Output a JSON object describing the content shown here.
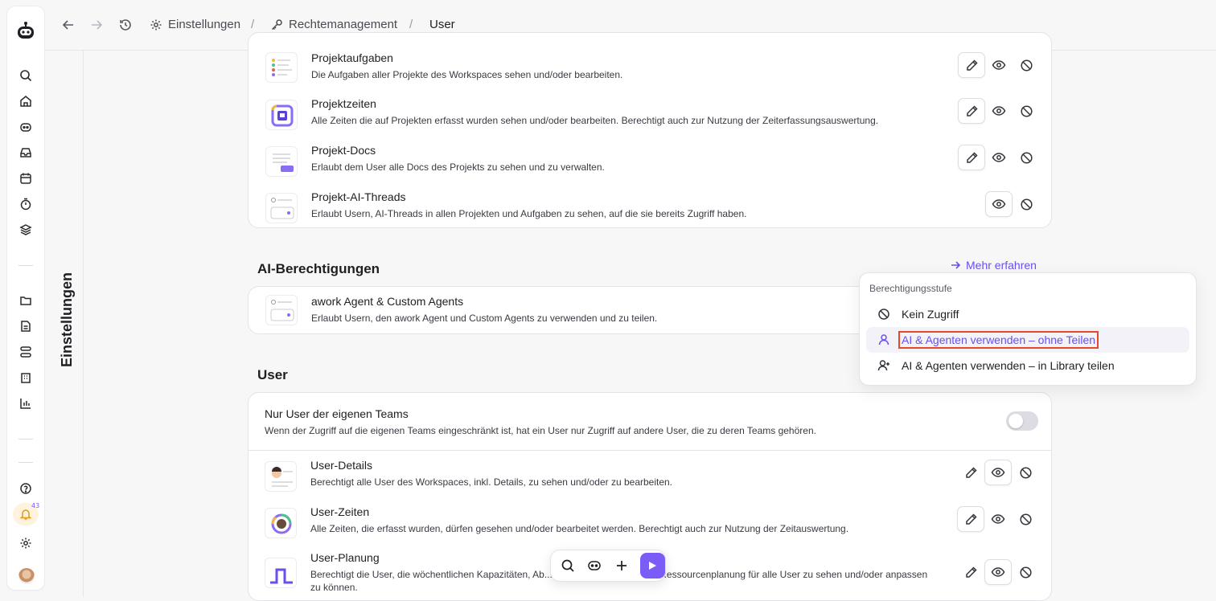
{
  "header": {
    "crumbs": [
      {
        "label": "Einstellungen",
        "icon": "gear-icon"
      },
      {
        "label": "Rechtemanagement",
        "icon": "key-icon"
      },
      {
        "label": "User",
        "icon": ""
      }
    ],
    "separator": "/"
  },
  "sidebar": {
    "vertical_label": "Einstellungen",
    "notification_count": "43",
    "icons": [
      "robot-logo-icon",
      "search-icon",
      "home-icon",
      "ai-agent-icon",
      "inbox-icon",
      "calendar-icon",
      "timer-icon",
      "layers-icon",
      "folder-icon",
      "document-icon",
      "workflow-icon",
      "company-icon",
      "chart-icon",
      "help-icon",
      "bell-icon",
      "settings-icon",
      "avatar"
    ]
  },
  "project_section": {
    "rows": [
      {
        "title": "Projektaufgaben",
        "desc": "Die Aufgaben aller Projekte des Workspaces sehen und/oder bearbeiten."
      },
      {
        "title": "Projektzeiten",
        "desc": "Alle Zeiten die auf Projekten erfasst wurden sehen und/oder bearbeiten. Berechtigt auch zur Nutzung der Zeiterfassungsauswertung."
      },
      {
        "title": "Projekt-Docs",
        "desc": "Erlaubt dem User alle Docs des Projekts zu sehen und zu verwalten."
      },
      {
        "title": "Projekt-AI-Threads",
        "desc": "Erlaubt Usern, AI-Threads in allen Projekten und Aufgaben zu sehen, auf die sie bereits Zugriff haben."
      }
    ]
  },
  "ai_section": {
    "title": "AI-Berechtigungen",
    "more_link": "Mehr erfahren",
    "rows": [
      {
        "title": "awork Agent & Custom Agents",
        "desc": "Erlaubt Usern, den awork Agent und Custom Agents zu verwenden und zu teilen."
      }
    ]
  },
  "user_section": {
    "title": "User",
    "toggle_row": {
      "title": "Nur User der eigenen Teams",
      "desc": "Wenn der Zugriff auf die eigenen Teams eingeschränkt ist, hat ein User nur Zugriff auf andere User, die zu deren Teams gehören.",
      "enabled": false
    },
    "rows": [
      {
        "title": "User-Details",
        "desc": "Berechtigt alle User des Workspaces, inkl. Details, zu sehen und/oder zu bearbeiten."
      },
      {
        "title": "User-Zeiten",
        "desc": "Alle Zeiten, die erfasst wurden, dürfen gesehen und/oder bearbeitet werden. Berechtigt auch zur Nutzung der Zeitauswertung."
      },
      {
        "title": "User-Planung",
        "desc": "Berechtigt die User, die wöchentlichen Kapazitäten, Ab... gets auf Projekte für die Ressourcenplanung für alle User zu sehen und/oder anpassen zu können."
      }
    ]
  },
  "popover": {
    "heading": "Berechtigungsstufe",
    "options": [
      {
        "label": "Kein Zugriff",
        "icon": "no-access-icon"
      },
      {
        "label": "AI & Agenten verwenden – ohne Teilen",
        "icon": "user-icon",
        "selected": true
      },
      {
        "label": "AI & Agenten verwenden – in Library teilen",
        "icon": "user-plus-icon"
      }
    ]
  },
  "colors": {
    "accent": "#6a4ff0",
    "highlight_outline": "#e24a2a",
    "play_button": "#7b5cf6"
  }
}
